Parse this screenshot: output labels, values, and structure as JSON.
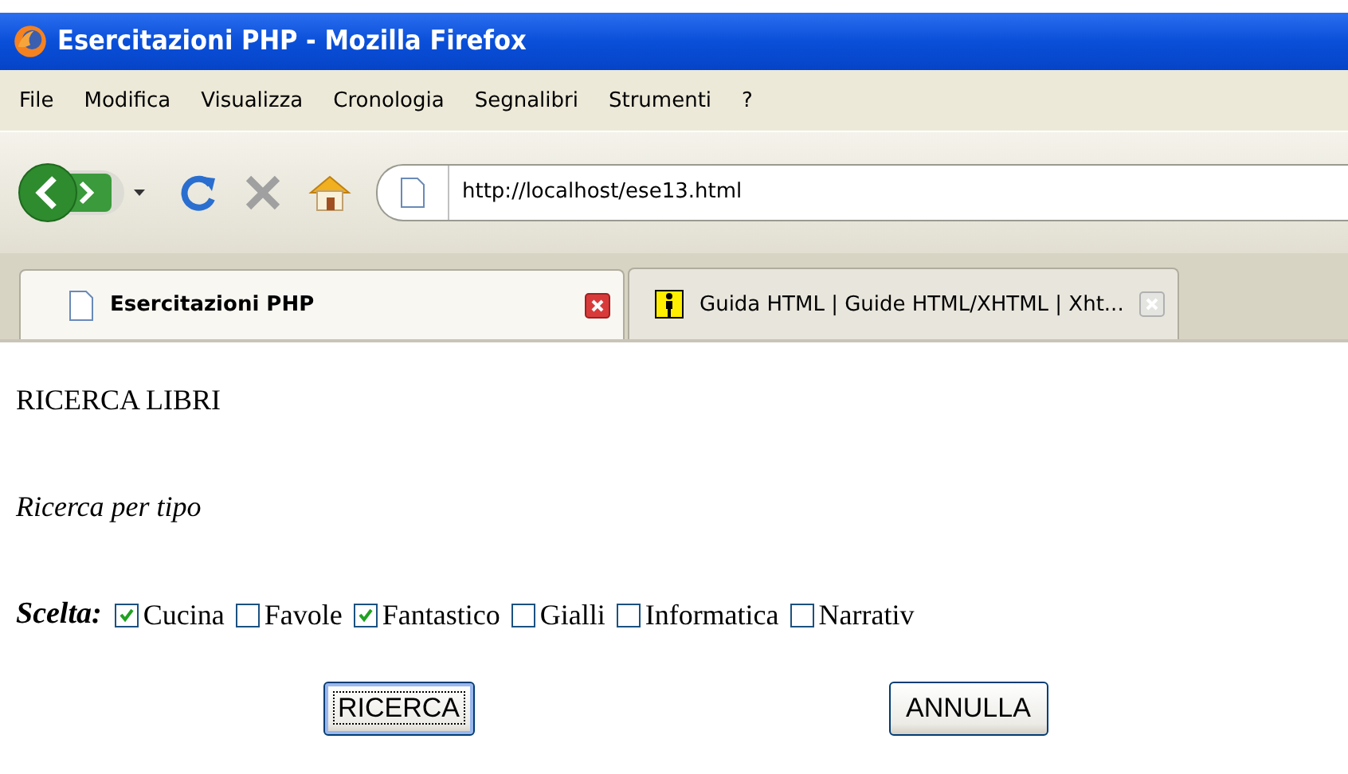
{
  "window": {
    "title": "Esercitazioni PHP - Mozilla Firefox"
  },
  "menu": [
    "File",
    "Modifica",
    "Visualizza",
    "Cronologia",
    "Segnalibri",
    "Strumenti",
    "?"
  ],
  "address": {
    "value": "http://localhost/ese13.html"
  },
  "tabs": [
    {
      "label": "Esercitazioni PHP",
      "selected": true
    },
    {
      "label": "Guida HTML | Guide HTML/XHTML | Xht...",
      "selected": false
    }
  ],
  "page": {
    "heading": "RICERCA LIBRI",
    "subheading": "Ricerca per tipo",
    "choice_label": "Scelta:",
    "options": [
      {
        "label": "Cucina",
        "checked": true
      },
      {
        "label": "Favole",
        "checked": false
      },
      {
        "label": "Fantastico",
        "checked": true
      },
      {
        "label": "Gialli",
        "checked": false
      },
      {
        "label": "Informatica",
        "checked": false
      },
      {
        "label": "Narrativ",
        "checked": false
      }
    ],
    "buttons": [
      {
        "label": "RICERCA",
        "focused": true
      },
      {
        "label": "ANNULLA",
        "focused": false
      }
    ]
  }
}
